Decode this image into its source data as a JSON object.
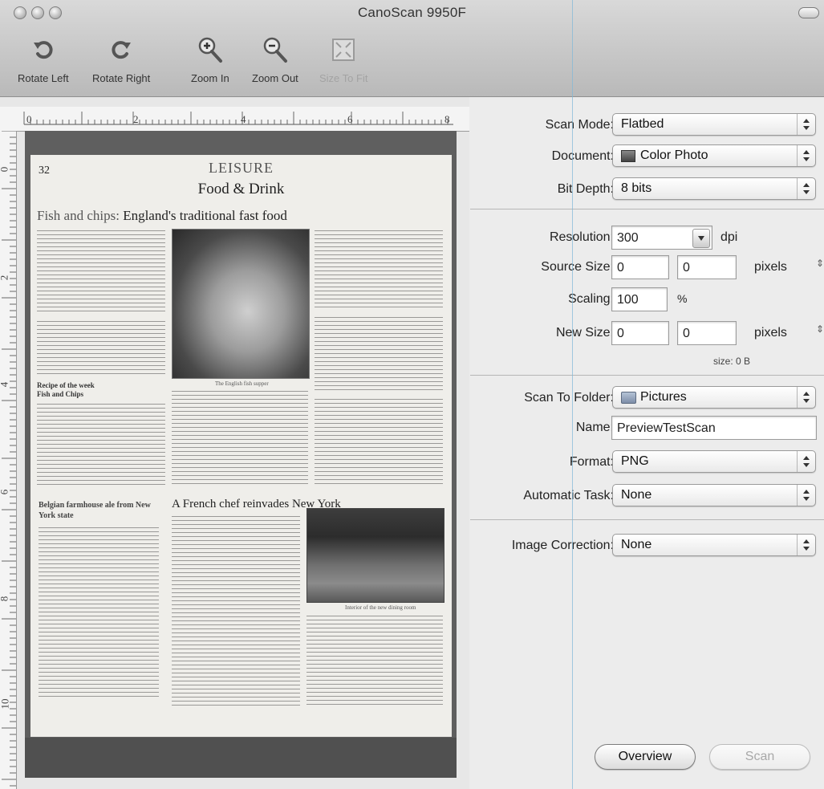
{
  "window": {
    "title": "CanoScan 9950F"
  },
  "toolbar": {
    "rotate_left": "Rotate Left",
    "rotate_right": "Rotate Right",
    "zoom_in": "Zoom In",
    "zoom_out": "Zoom Out",
    "size_to_fit": "Size To Fit"
  },
  "ruler": {
    "top": [
      "0",
      "2",
      "4",
      "6",
      "8"
    ],
    "left": [
      "0",
      "2",
      "4",
      "6",
      "8",
      "10"
    ]
  },
  "document_preview": {
    "page_number": "32",
    "section": "LEISURE",
    "subsection": "Food & Drink",
    "headline_lead": "Fish and chips:",
    "headline_rest": " England's traditional fast food",
    "sidebar_label": "Recipe of the week",
    "sidebar_sub": "Fish and Chips",
    "side_headline": "Belgian farmhouse ale from New York state",
    "chef_headline": "A French chef reinvades New York"
  },
  "settings": {
    "scan_mode": {
      "label": "Scan Mode:",
      "value": "Flatbed"
    },
    "document": {
      "label": "Document:",
      "value": "Color Photo"
    },
    "bit_depth": {
      "label": "Bit Depth:",
      "value": "8 bits"
    },
    "resolution": {
      "label": "Resolution:",
      "value": "300",
      "unit": "dpi"
    },
    "source_size": {
      "label": "Source Size:",
      "width": "0",
      "height": "0",
      "unit": "pixels"
    },
    "scaling": {
      "label": "Scaling:",
      "value": "100",
      "unit": "%"
    },
    "new_size": {
      "label": "New Size:",
      "width": "0",
      "height": "0",
      "unit": "pixels"
    },
    "size_note": "size: 0 B",
    "scan_to_folder": {
      "label": "Scan To Folder:",
      "value": "Pictures"
    },
    "name": {
      "label": "Name:",
      "value": "PreviewTestScan"
    },
    "format": {
      "label": "Format:",
      "value": "PNG"
    },
    "automatic_task": {
      "label": "Automatic Task:",
      "value": "None"
    },
    "image_correction": {
      "label": "Image Correction:",
      "value": "None"
    }
  },
  "buttons": {
    "overview": "Overview",
    "scan": "Scan"
  }
}
